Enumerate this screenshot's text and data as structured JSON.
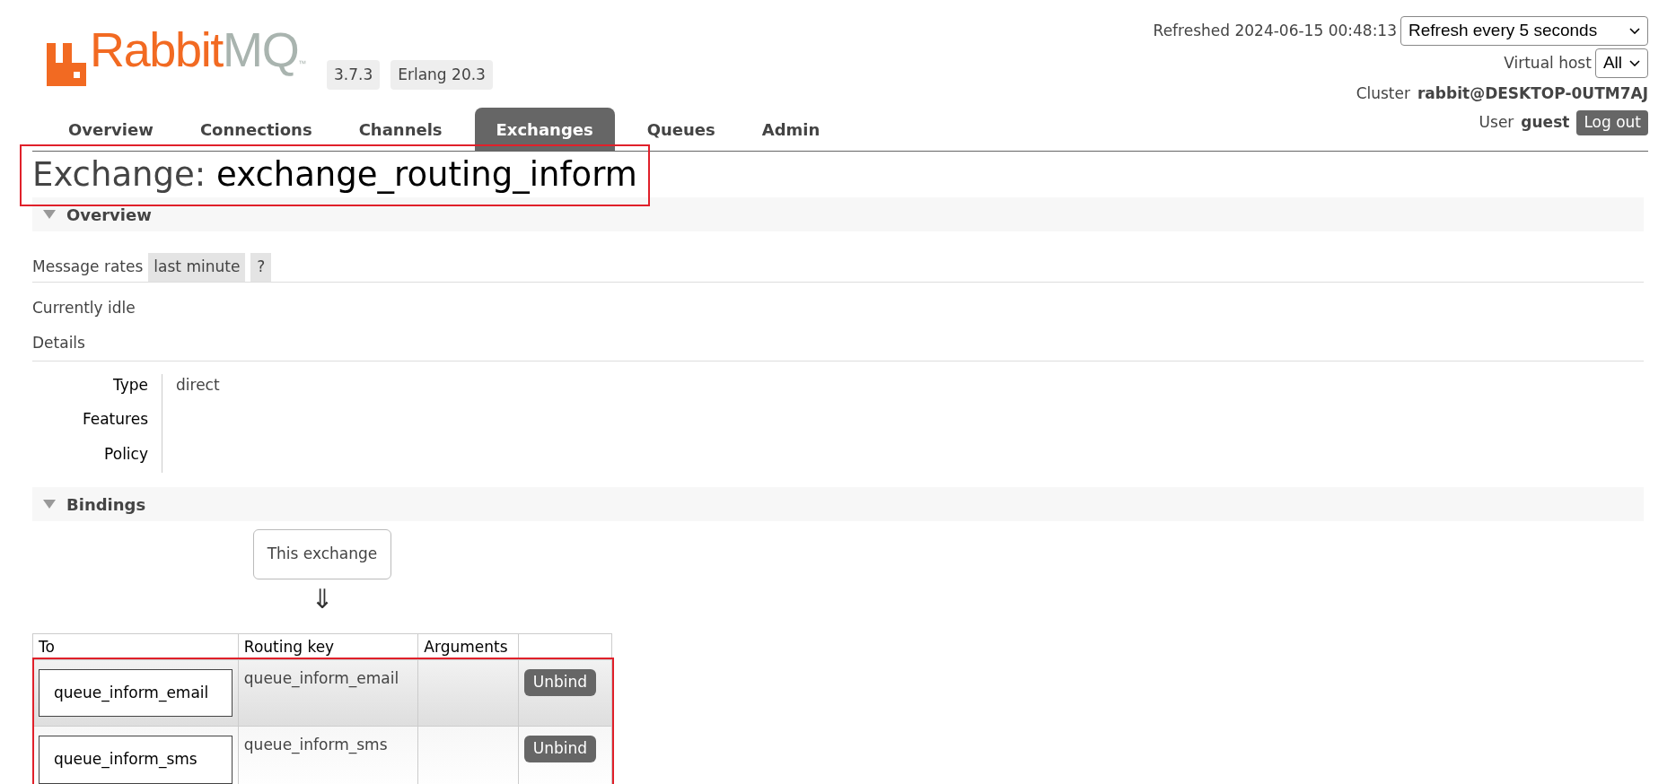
{
  "header": {
    "logo": {
      "brand": "Rabbit",
      "suffix": "MQ",
      "trademark": "™"
    },
    "badges": [
      "3.7.3",
      "Erlang 20.3"
    ]
  },
  "top_right": {
    "refreshed": "Refreshed 2024-06-15 00:48:13",
    "refresh_select": "Refresh every 5 seconds",
    "vhost_label": "Virtual host",
    "vhost_select": "All",
    "cluster_label": "Cluster",
    "cluster_name": "rabbit@DESKTOP-0UTM7AJ",
    "user_label": "User",
    "user_name": "guest",
    "logout": "Log out"
  },
  "tabs": [
    {
      "label": "Overview",
      "selected": false
    },
    {
      "label": "Connections",
      "selected": false
    },
    {
      "label": "Channels",
      "selected": false
    },
    {
      "label": "Exchanges",
      "selected": true
    },
    {
      "label": "Queues",
      "selected": false
    },
    {
      "label": "Admin",
      "selected": false
    }
  ],
  "title": {
    "prefix": "Exchange:",
    "name": "exchange_routing_inform"
  },
  "overview": {
    "heading": "Overview",
    "expanded": true,
    "rates_label": "Message rates",
    "rates_period": "last minute",
    "help": "?",
    "status": "Currently idle",
    "details_heading": "Details",
    "details": [
      {
        "label": "Type",
        "value": "direct"
      },
      {
        "label": "Features"
      },
      {
        "label": "Policy"
      }
    ]
  },
  "bindings": {
    "heading": "Bindings",
    "expanded": true,
    "source": "This exchange",
    "arrow": "⇓",
    "columns": [
      "To",
      "Routing key",
      "Arguments"
    ],
    "rows": [
      {
        "to": "queue_inform_email",
        "routing_key": "queue_inform_email",
        "action": "Unbind"
      },
      {
        "to": "queue_inform_sms",
        "routing_key": "queue_inform_sms",
        "action": "Unbind"
      }
    ]
  }
}
